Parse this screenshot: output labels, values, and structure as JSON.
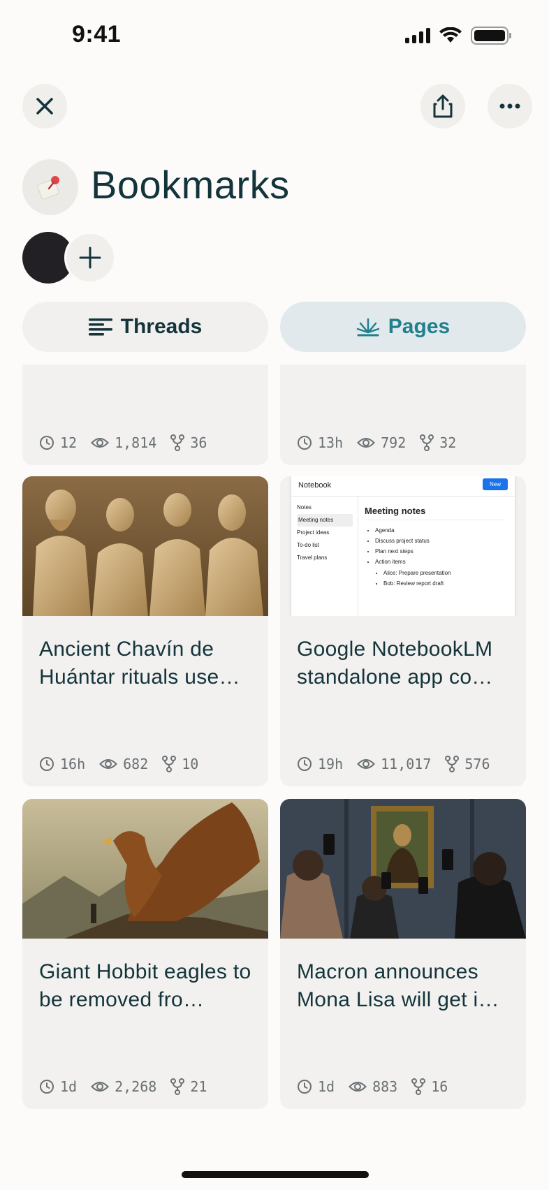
{
  "status_bar": {
    "time": "9:41"
  },
  "header": {
    "title": "Bookmarks"
  },
  "tabs": [
    {
      "label": "Threads",
      "active": false
    },
    {
      "label": "Pages",
      "active": true
    }
  ],
  "colors": {
    "accent": "#20808d",
    "title": "#13343b",
    "card_bg": "#f2f1ef"
  },
  "cards": [
    {
      "title": "",
      "time": "12",
      "views": "1,814",
      "forks": "36",
      "image": "none"
    },
    {
      "title": "",
      "time": "13h",
      "views": "792",
      "forks": "32",
      "image": "none"
    },
    {
      "title": "Ancient Chavín de Huántar rituals use…",
      "time": "16h",
      "views": "682",
      "forks": "10",
      "image": "ancient-statues"
    },
    {
      "title": "Google NotebookLM standalone app co…",
      "time": "19h",
      "views": "11,017",
      "forks": "576",
      "image": "notebook-screenshot"
    },
    {
      "title": "Giant Hobbit eagles to be removed fro…",
      "time": "1d",
      "views": "2,268",
      "forks": "21",
      "image": "giant-eagle"
    },
    {
      "title": "Macron announces Mona Lisa will get i…",
      "time": "1d",
      "views": "883",
      "forks": "16",
      "image": "mona-lisa-crowd"
    }
  ],
  "notebook_preview": {
    "app_name": "Notebook",
    "new_button": "New",
    "sidebar": [
      "Notes",
      "Meeting notes",
      "Project ideas",
      "To-do list",
      "Travel plans"
    ],
    "doc_title": "Meeting notes",
    "bullets": [
      "Agenda",
      "Discuss project status",
      "Plan next steps",
      "Action items"
    ],
    "sub_bullets": [
      "Alice: Prepare presentation",
      "Bob: Review report draft"
    ]
  }
}
